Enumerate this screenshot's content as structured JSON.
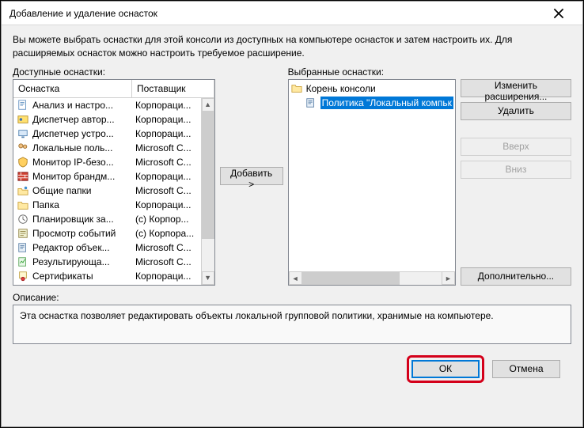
{
  "title": "Добавление и удаление оснасток",
  "intro": "Вы можете выбрать оснастки для этой консоли из доступных на компьютере оснасток и затем настроить их. Для расширяемых оснасток можно настроить требуемое расширение.",
  "labels": {
    "available": "Доступные оснастки:",
    "selected": "Выбранные оснастки:",
    "description": "Описание:"
  },
  "headers": {
    "name": "Оснастка",
    "vendor": "Поставщик"
  },
  "available": [
    {
      "name": "Анализ и настро...",
      "vendor": "Корпораци...",
      "icon": "doc"
    },
    {
      "name": "Диспетчер автор...",
      "vendor": "Корпораци...",
      "icon": "auth"
    },
    {
      "name": "Диспетчер устро...",
      "vendor": "Корпораци...",
      "icon": "device"
    },
    {
      "name": "Локальные поль...",
      "vendor": "Microsoft C...",
      "icon": "users"
    },
    {
      "name": "Монитор IP-безо...",
      "vendor": "Microsoft C...",
      "icon": "ipsec"
    },
    {
      "name": "Монитор брандм...",
      "vendor": "Корпораци...",
      "icon": "firewall"
    },
    {
      "name": "Общие папки",
      "vendor": "Microsoft C...",
      "icon": "share"
    },
    {
      "name": "Папка",
      "vendor": "Корпораци...",
      "icon": "folder"
    },
    {
      "name": "Планировщик за...",
      "vendor": "(с) Корпор...",
      "icon": "sched"
    },
    {
      "name": "Просмотр событий",
      "vendor": "(с) Корпора...",
      "icon": "event"
    },
    {
      "name": "Редактор объек...",
      "vendor": "Microsoft C...",
      "icon": "gpedit"
    },
    {
      "name": "Результирующа...",
      "vendor": "Microsoft C...",
      "icon": "rsop"
    },
    {
      "name": "Сертификаты",
      "vendor": "Корпораци...",
      "icon": "cert"
    }
  ],
  "tree": {
    "root": "Корень консоли",
    "child": "Политика \"Локальный компьк"
  },
  "buttons": {
    "add": "Добавить >",
    "edit_ext": "Изменить расширения...",
    "remove": "Удалить",
    "up": "Вверх",
    "down": "Вниз",
    "advanced": "Дополнительно...",
    "ok": "ОК",
    "cancel": "Отмена"
  },
  "description_text": "Эта оснастка позволяет редактировать объекты локальной групповой политики, хранимые на компьютере."
}
